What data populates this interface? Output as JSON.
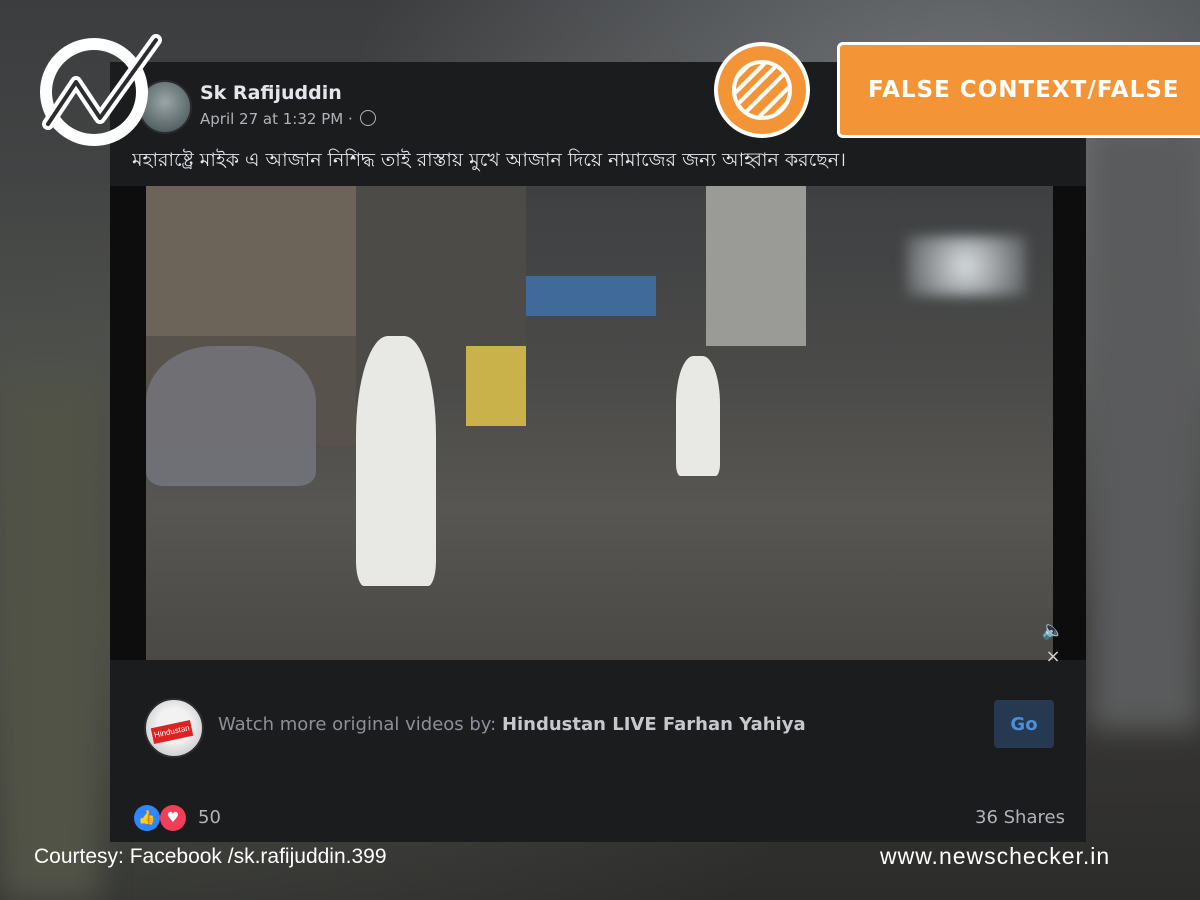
{
  "post": {
    "author": "Sk Rafijuddin",
    "meta": "April 27 at 1:32 PM ·",
    "caption": "মহারাষ্ট্রে মাইক এ আজান নিশিদ্ধ তাই রাস্তায় মুখে আজান দিয়ে নামাজের জন্য আহ্বান করছেন।"
  },
  "video": {
    "mute_icon": "🔈×"
  },
  "watch_bar": {
    "prefix": "Watch more original videos by: ",
    "channel": "Hindustan LIVE Farhan Yahiya",
    "go_label": "Go"
  },
  "engagement": {
    "like_icon": "👍",
    "love_icon": "♥",
    "reactions": "50",
    "shares": "36 Shares"
  },
  "overlay": {
    "verdict": "FALSE CONTEXT/FALSE",
    "courtesy": "Courtesy: Facebook /sk.rafijuddin.399",
    "site": "www.newschecker.in",
    "accent_color": "#f39536"
  }
}
